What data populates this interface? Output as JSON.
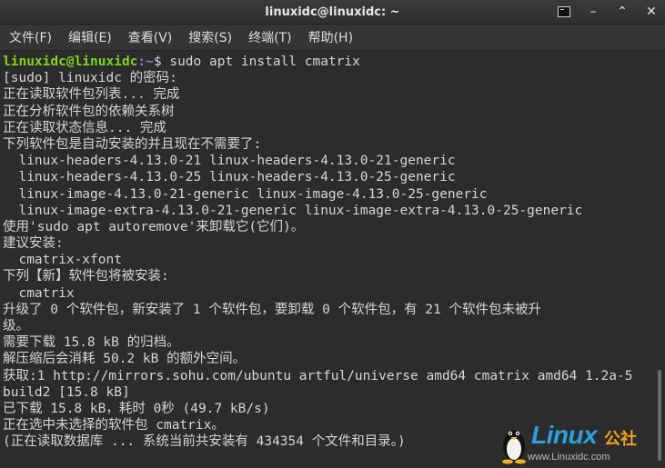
{
  "window": {
    "title": "linuxidc@linuxidc: ~"
  },
  "menu": {
    "items": [
      "文件(F)",
      "编辑(E)",
      "查看(V)",
      "搜索(S)",
      "终端(T)",
      "帮助(H)"
    ]
  },
  "prompt": {
    "user": "linuxidc@linuxidc",
    "path": ":~",
    "symbol": "$ ",
    "command": "sudo apt install cmatrix"
  },
  "output_lines": [
    "[sudo] linuxidc 的密码:",
    "正在读取软件包列表... 完成",
    "正在分析软件包的依赖关系树",
    "正在读取状态信息... 完成",
    "下列软件包是自动安装的并且现在不需要了:",
    "  linux-headers-4.13.0-21 linux-headers-4.13.0-21-generic",
    "  linux-headers-4.13.0-25 linux-headers-4.13.0-25-generic",
    "  linux-image-4.13.0-21-generic linux-image-4.13.0-25-generic",
    "  linux-image-extra-4.13.0-21-generic linux-image-extra-4.13.0-25-generic",
    "使用'sudo apt autoremove'来卸载它(它们)。",
    "建议安装:",
    "  cmatrix-xfont",
    "下列【新】软件包将被安装:",
    "  cmatrix",
    "升级了 0 个软件包，新安装了 1 个软件包，要卸载 0 个软件包，有 21 个软件包未被升",
    "级。",
    "需要下载 15.8 kB 的归档。",
    "解压缩后会消耗 50.2 kB 的额外空间。",
    "获取:1 http://mirrors.sohu.com/ubuntu artful/universe amd64 cmatrix amd64 1.2a-5",
    "build2 [15.8 kB]",
    "已下载 15.8 kB，耗时 0秒 (49.7 kB/s)",
    "正在选中未选择的软件包 cmatrix。",
    "(正在读取数据库 ... 系统当前共安装有 434354 个文件和目录。)"
  ],
  "watermark": {
    "brand": "Linux",
    "cn": "公社",
    "url": "www.Linuxidc.com"
  },
  "colors": {
    "prompt_user": "#7ad51e",
    "prompt_path": "#6a8fd4",
    "text": "#d6d6d6",
    "background": "#2c2c2c"
  }
}
